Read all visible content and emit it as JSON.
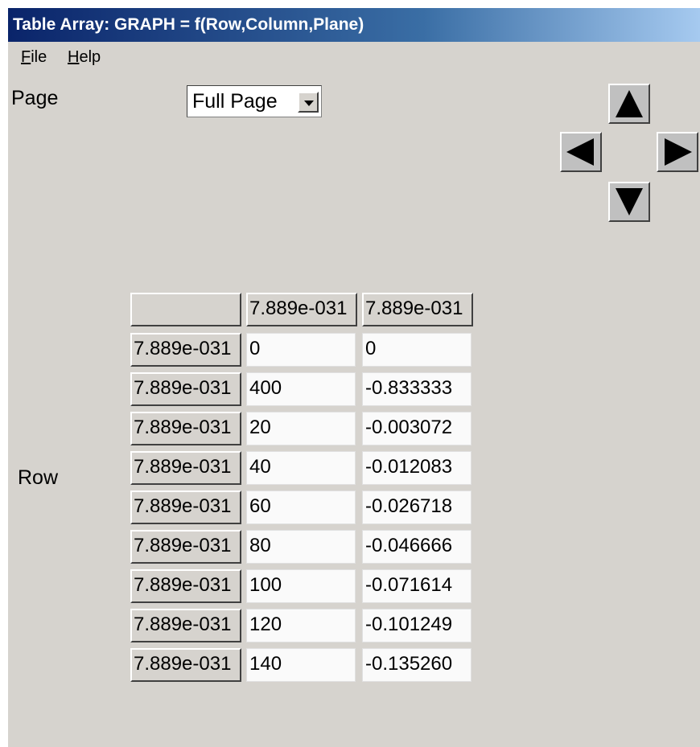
{
  "window": {
    "title": "Table Array: GRAPH = f(Row,Column,Plane)"
  },
  "menu": [
    {
      "underline": "F",
      "rest": "ile"
    },
    {
      "underline": "H",
      "rest": "elp"
    }
  ],
  "page": {
    "label": "Page",
    "selected": "Full Page"
  },
  "nav": {
    "up_icon": "arrow-up-icon",
    "left_icon": "arrow-left-icon",
    "right_icon": "arrow-right-icon",
    "down_icon": "arrow-down-icon"
  },
  "table": {
    "row_label": "Row",
    "corner": "",
    "column_headers": [
      "7.889e-031",
      "7.889e-031"
    ],
    "rows": [
      {
        "header": "7.889e-031",
        "cells": [
          "0",
          "0"
        ]
      },
      {
        "header": "7.889e-031",
        "cells": [
          "400",
          "-0.833333"
        ]
      },
      {
        "header": "7.889e-031",
        "cells": [
          "20",
          "-0.003072"
        ]
      },
      {
        "header": "7.889e-031",
        "cells": [
          "40",
          "-0.012083"
        ]
      },
      {
        "header": "7.889e-031",
        "cells": [
          "60",
          "-0.026718"
        ]
      },
      {
        "header": "7.889e-031",
        "cells": [
          "80",
          "-0.046666"
        ]
      },
      {
        "header": "7.889e-031",
        "cells": [
          "100",
          "-0.071614"
        ]
      },
      {
        "header": "7.889e-031",
        "cells": [
          "120",
          "-0.101249"
        ]
      },
      {
        "header": "7.889e-031",
        "cells": [
          "140",
          "-0.135260"
        ]
      }
    ]
  }
}
